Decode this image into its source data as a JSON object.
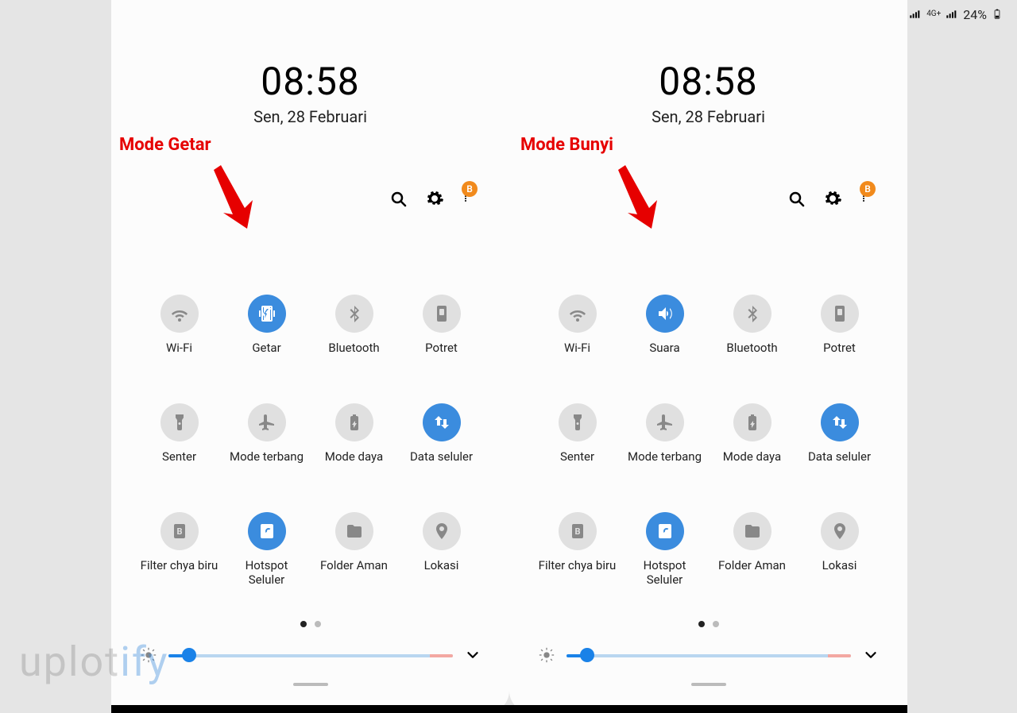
{
  "status": {
    "battery_pct": "24%",
    "network": "4G+"
  },
  "panels": [
    {
      "time": "08:58",
      "date": "Sen, 28 Februari",
      "annotation": "Mode Getar",
      "badge": "B",
      "tiles": [
        {
          "label": "Wi-Fi",
          "icon": "wifi",
          "active": false
        },
        {
          "label": "Getar",
          "icon": "vibrate",
          "active": true
        },
        {
          "label": "Bluetooth",
          "icon": "bluetooth",
          "active": false
        },
        {
          "label": "Potret",
          "icon": "portrait",
          "active": false
        },
        {
          "label": "Senter",
          "icon": "flashlight",
          "active": false
        },
        {
          "label": "Mode terbang",
          "icon": "airplane",
          "active": false
        },
        {
          "label": "Mode daya",
          "icon": "battery",
          "active": false
        },
        {
          "label": "Data seluler",
          "icon": "data",
          "active": true
        },
        {
          "label": "Filter chya biru",
          "icon": "bluelight",
          "active": false
        },
        {
          "label": "Hotspot Seluler",
          "icon": "hotspot",
          "active": true
        },
        {
          "label": "Folder Aman",
          "icon": "folder",
          "active": false
        },
        {
          "label": "Lokasi",
          "icon": "location",
          "active": false
        }
      ]
    },
    {
      "time": "08:58",
      "date": "Sen, 28 Februari",
      "annotation": "Mode Bunyi",
      "badge": "B",
      "tiles": [
        {
          "label": "Wi-Fi",
          "icon": "wifi",
          "active": false
        },
        {
          "label": "Suara",
          "icon": "sound",
          "active": true
        },
        {
          "label": "Bluetooth",
          "icon": "bluetooth",
          "active": false
        },
        {
          "label": "Potret",
          "icon": "portrait",
          "active": false
        },
        {
          "label": "Senter",
          "icon": "flashlight",
          "active": false
        },
        {
          "label": "Mode terbang",
          "icon": "airplane",
          "active": false
        },
        {
          "label": "Mode daya",
          "icon": "battery",
          "active": false
        },
        {
          "label": "Data seluler",
          "icon": "data",
          "active": true
        },
        {
          "label": "Filter chya biru",
          "icon": "bluelight",
          "active": false
        },
        {
          "label": "Hotspot Seluler",
          "icon": "hotspot",
          "active": true
        },
        {
          "label": "Folder Aman",
          "icon": "folder",
          "active": false
        },
        {
          "label": "Lokasi",
          "icon": "location",
          "active": false
        }
      ]
    }
  ],
  "watermark": {
    "pre": "uplot",
    "accent": "ify"
  }
}
